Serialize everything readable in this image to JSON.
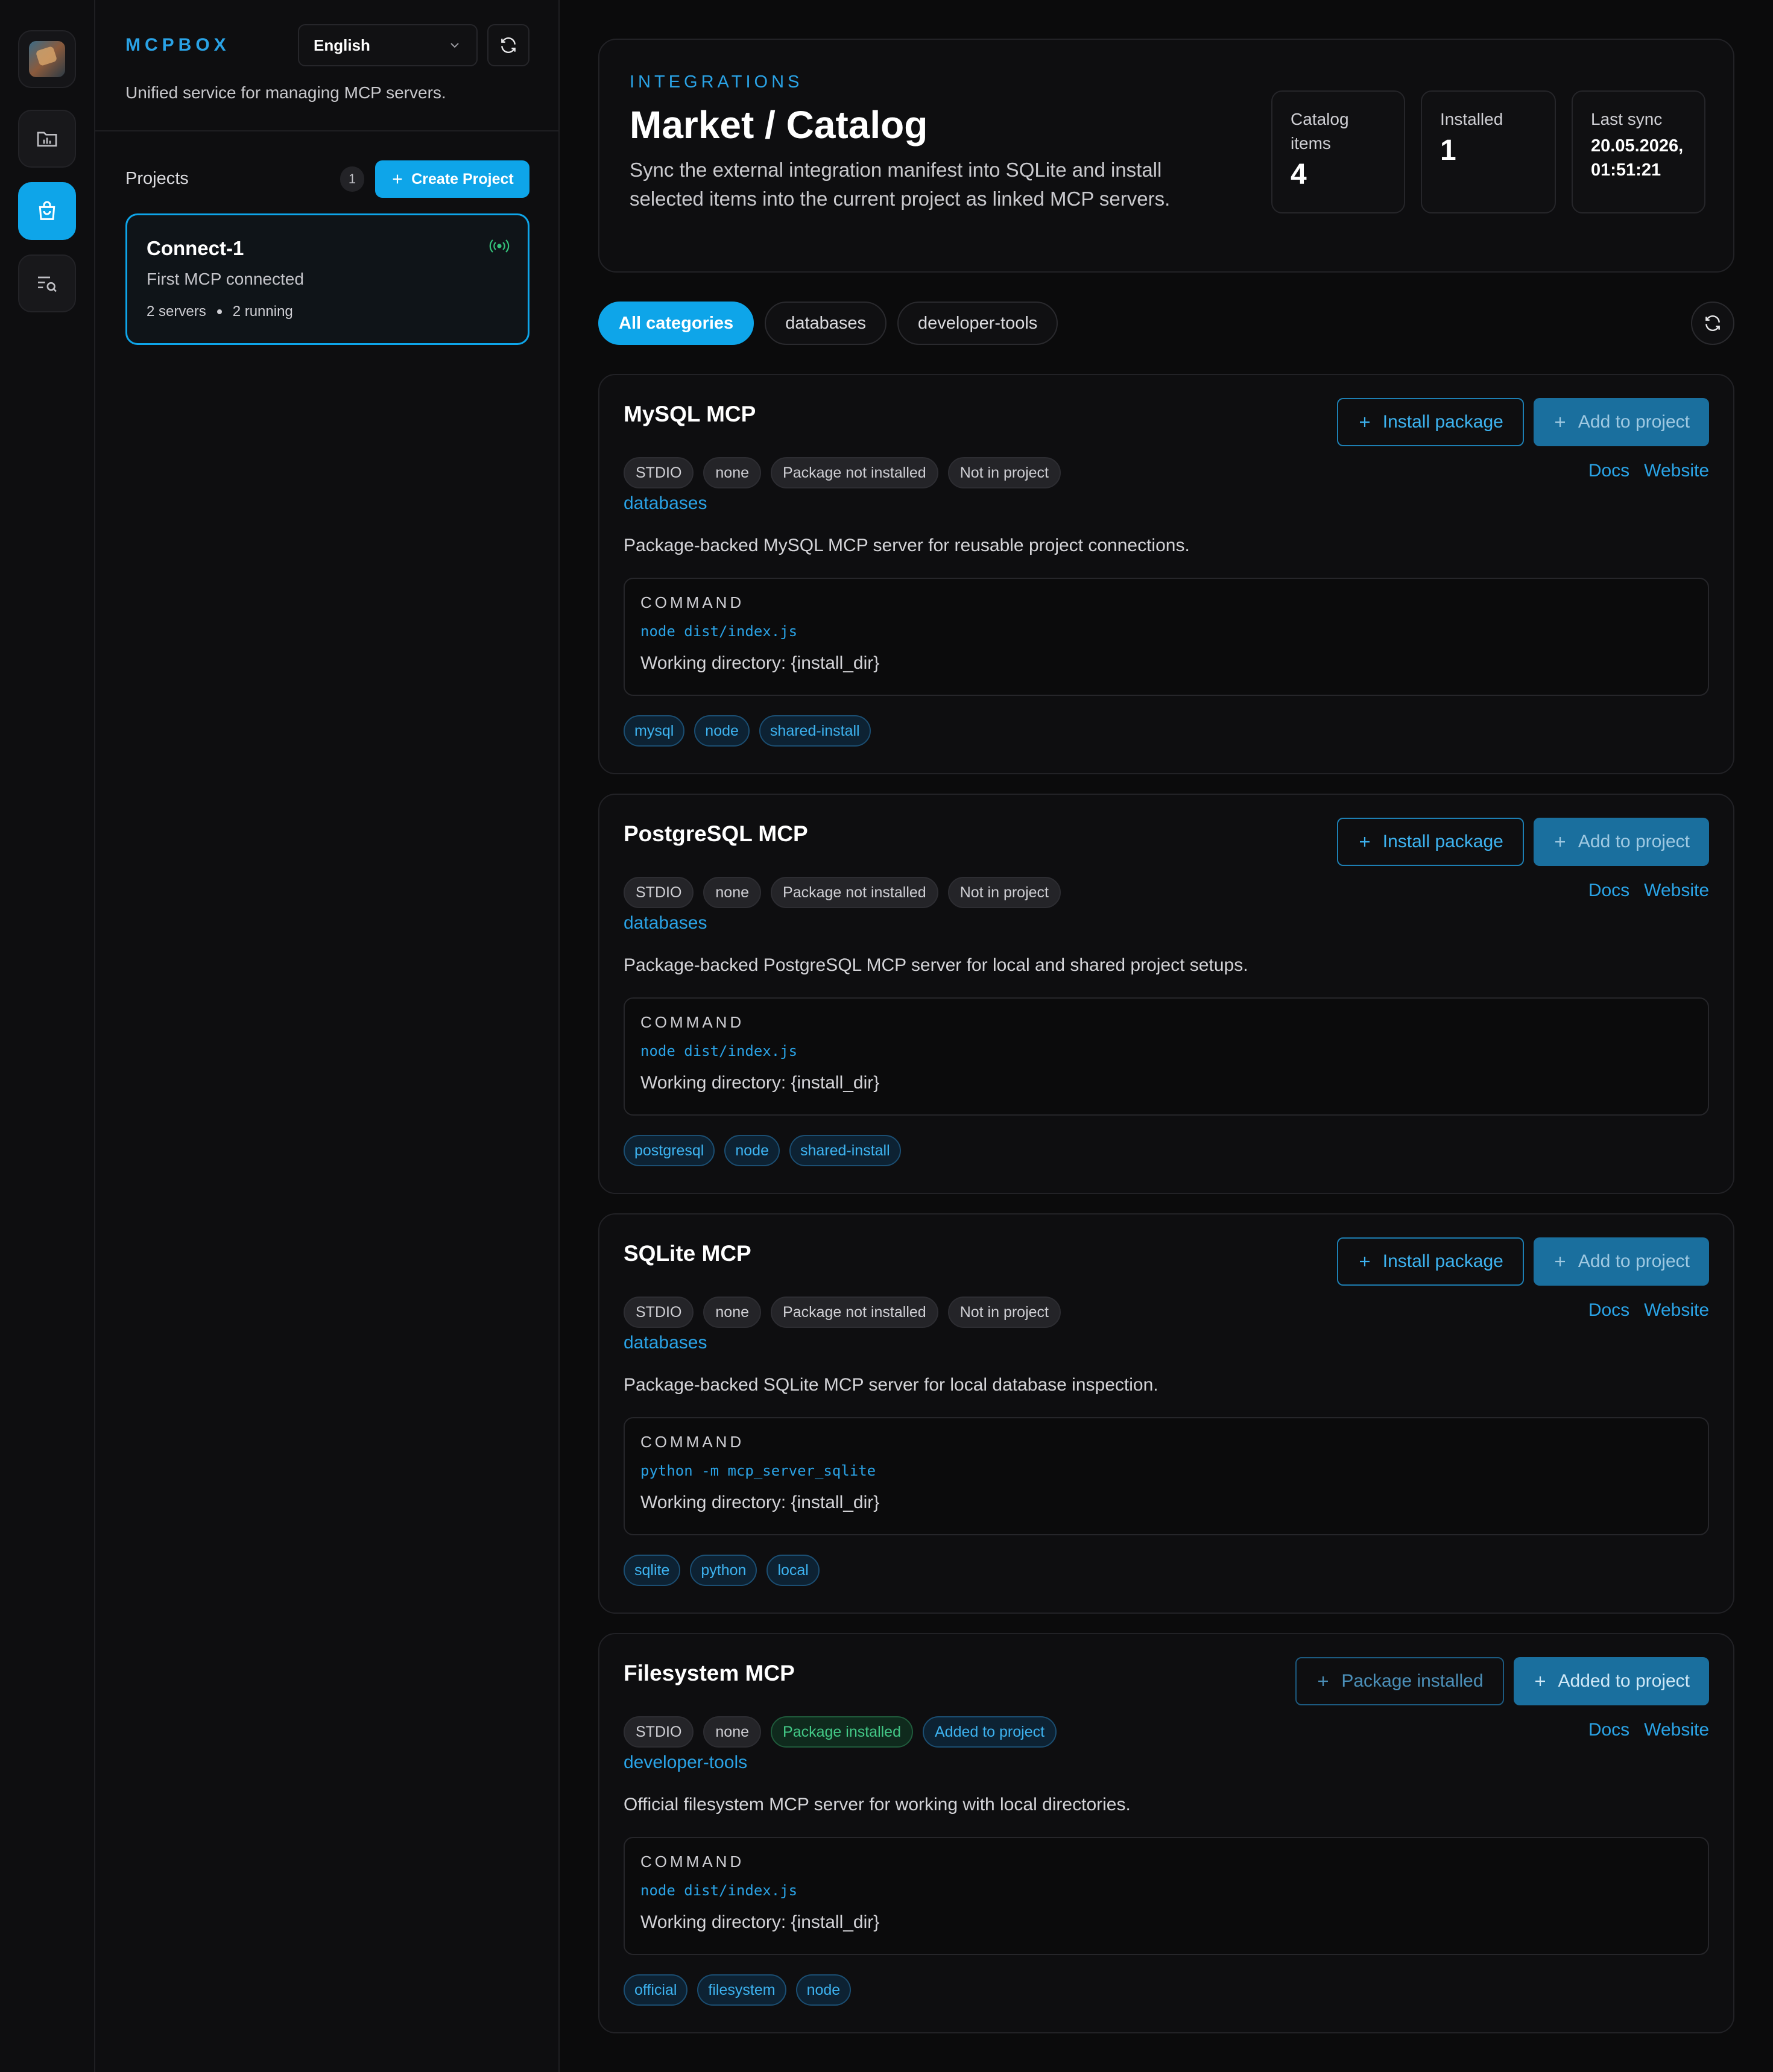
{
  "sidebar": {
    "brand": "MCPBOX",
    "language": "English",
    "tagline": "Unified service for managing MCP servers.",
    "projects_label": "Projects",
    "projects_count": "1",
    "create_project": "Create Project",
    "project": {
      "name": "Connect-1",
      "description": "First MCP connected",
      "servers": "2 servers",
      "running": "2 running"
    }
  },
  "rail": {
    "icons": [
      "logo",
      "projects-icon",
      "market-icon",
      "logs-icon"
    ],
    "active": "market-icon"
  },
  "hero": {
    "eyebrow": "INTEGRATIONS",
    "title": "Market / Catalog",
    "description": "Sync the external integration manifest into SQLite and install selected items into the current project as linked MCP servers.",
    "stats": {
      "catalog_label": "Catalog items",
      "catalog_value": "4",
      "installed_label": "Installed",
      "installed_value": "1",
      "sync_label": "Last sync",
      "sync_date": "20.05.2026,",
      "sync_time": "01:51:21"
    }
  },
  "filters": {
    "all": "All categories",
    "databases": "databases",
    "developer_tools": "developer-tools"
  },
  "common": {
    "command_label": "COMMAND",
    "docs": "Docs",
    "website": "Website"
  },
  "items": [
    {
      "title": "MySQL MCP",
      "install_label": "Install package",
      "add_label": "Add to project",
      "transport": "STDIO",
      "auth": "none",
      "package_status": "Package not installed",
      "project_status": "Not in project",
      "category": "databases",
      "description": "Package-backed MySQL MCP server for reusable project connections.",
      "command": "node dist/index.js",
      "working_dir": "Working directory: {install_dir}",
      "tags": [
        "mysql",
        "node",
        "shared-install"
      ]
    },
    {
      "title": "PostgreSQL MCP",
      "install_label": "Install package",
      "add_label": "Add to project",
      "transport": "STDIO",
      "auth": "none",
      "package_status": "Package not installed",
      "project_status": "Not in project",
      "category": "databases",
      "description": "Package-backed PostgreSQL MCP server for local and shared project setups.",
      "command": "node dist/index.js",
      "working_dir": "Working directory: {install_dir}",
      "tags": [
        "postgresql",
        "node",
        "shared-install"
      ]
    },
    {
      "title": "SQLite MCP",
      "install_label": "Install package",
      "add_label": "Add to project",
      "transport": "STDIO",
      "auth": "none",
      "package_status": "Package not installed",
      "project_status": "Not in project",
      "category": "databases",
      "description": "Package-backed SQLite MCP server for local database inspection.",
      "command": "python -m mcp_server_sqlite",
      "working_dir": "Working directory: {install_dir}",
      "tags": [
        "sqlite",
        "python",
        "local"
      ]
    },
    {
      "title": "Filesystem MCP",
      "install_label": "Package installed",
      "add_label": "Added to project",
      "transport": "STDIO",
      "auth": "none",
      "package_status": "Package installed",
      "project_status": "Added to project",
      "category": "developer-tools",
      "description": "Official filesystem MCP server for working with local directories.",
      "command": "node dist/index.js",
      "working_dir": "Working directory: {install_dir}",
      "tags": [
        "official",
        "filesystem",
        "node"
      ]
    }
  ]
}
